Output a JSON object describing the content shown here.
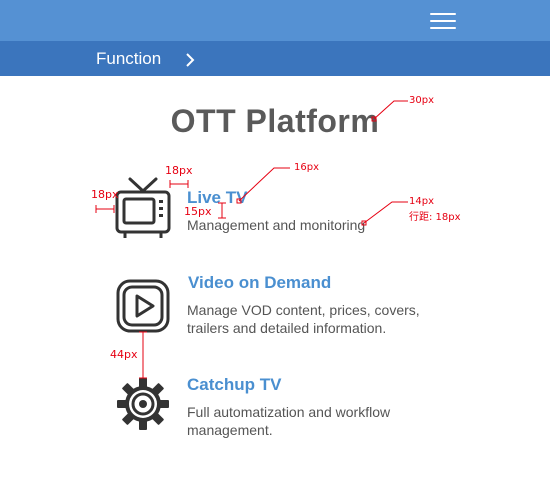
{
  "topbar": {
    "menu_icon": "hamburger-menu-icon"
  },
  "subbar": {
    "label": "Function",
    "chevron_icon": "chevron-right-icon"
  },
  "page": {
    "title": "OTT Platform"
  },
  "features": [
    {
      "icon": "tv-icon",
      "title": "Live TV",
      "description": "Management and monitoring"
    },
    {
      "icon": "play-icon",
      "title": "Video on Demand",
      "description": "Manage VOD content, prices, covers, trailers and detailed information."
    },
    {
      "icon": "gear-icon",
      "title": "Catchup TV",
      "description": "Full automatization and workflow management."
    }
  ],
  "annotations": {
    "title_size": "30px",
    "icon_gap": "18px",
    "icon_side": "18px",
    "feature_title_size": "16px",
    "title_desc_gap": "15px",
    "desc_size": "14px",
    "desc_line_height": "行距: 18px",
    "feature_spacing": "44px"
  },
  "colors": {
    "topbar": "#5591d3",
    "subbar": "#3b75bd",
    "accent": "#4a8fd0",
    "annotation": "#e60012"
  }
}
